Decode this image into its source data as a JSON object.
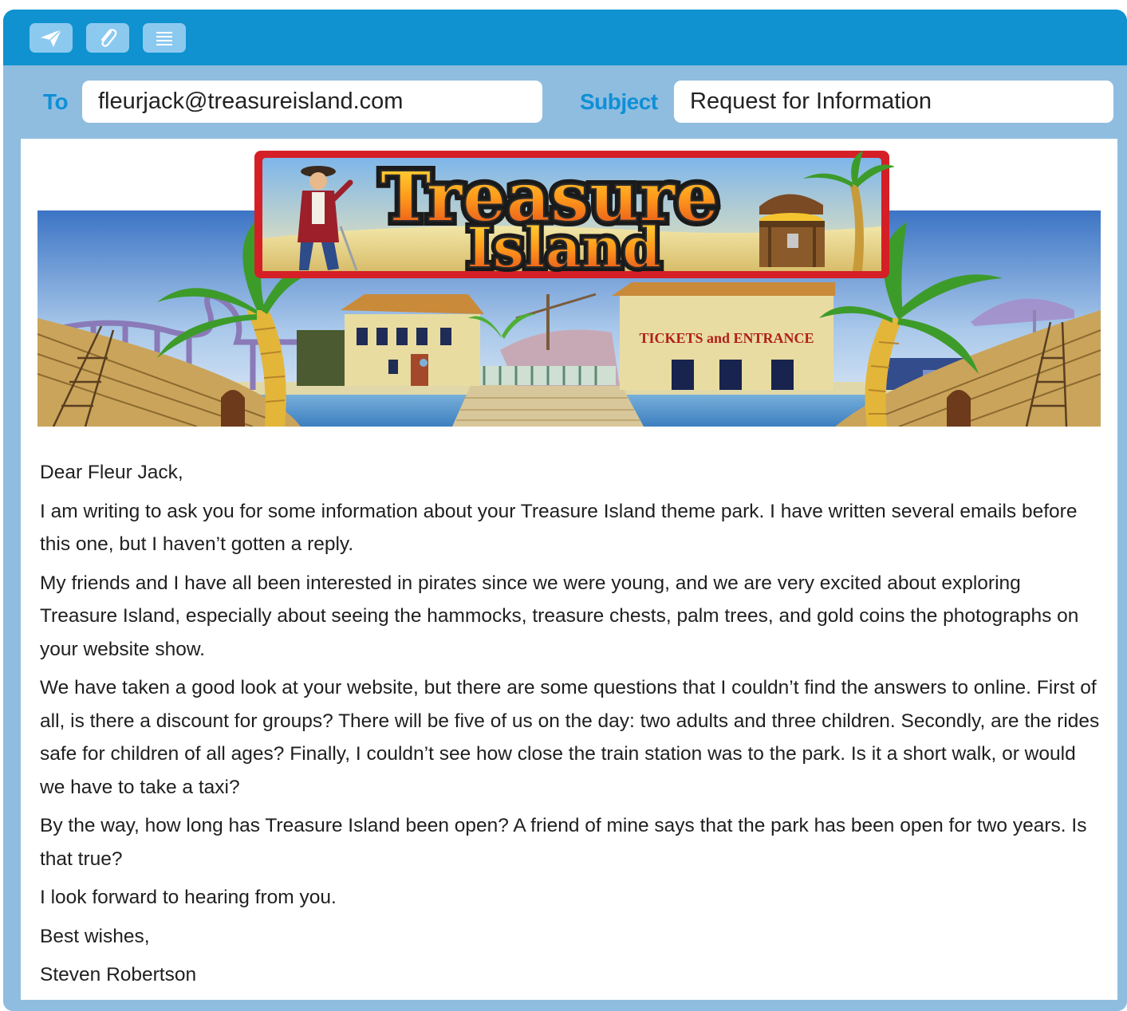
{
  "toolbar": {
    "send_icon": "paper-plane-icon",
    "attach_icon": "paperclip-icon",
    "format_icon": "text-lines-icon"
  },
  "header": {
    "to_label": "To",
    "to_value": "fleurjack@treasureisland.com",
    "subject_label": "Subject",
    "subject_value": "Request for Information"
  },
  "banner": {
    "logo_line1": "Treasure",
    "logo_line2": "Island",
    "sign_text": "TICKETS and ENTRANCE"
  },
  "letter": {
    "greeting": "Dear Fleur Jack,",
    "paragraphs": [
      "I am writing to ask you for some information about your Treasure Island theme park. I have written several emails before this one, but I haven’t gotten a reply.",
      "My friends and I have all been interested in pirates since we were young, and we are very excited about exploring Treasure Island, especially about seeing the hammocks, treasure chests, palm trees, and gold coins the photographs on your website show.",
      "We have taken a good look at your website, but there are some questions that I couldn’t find the answers to online. First of all, is there a discount for groups? There will be five of us on the day: two adults and three children. Secondly, are the rides safe for children of all ages? Finally, I couldn’t see how close the train station was to the park. Is it a short walk, or would we have to take a taxi?",
      "By the way, how long has Treasure Island been open? A friend of mine says that the park has been open for two years. Is that true?",
      "I look forward to hearing from you."
    ],
    "closing": "Best wishes,",
    "signature": "Steven Robertson"
  }
}
